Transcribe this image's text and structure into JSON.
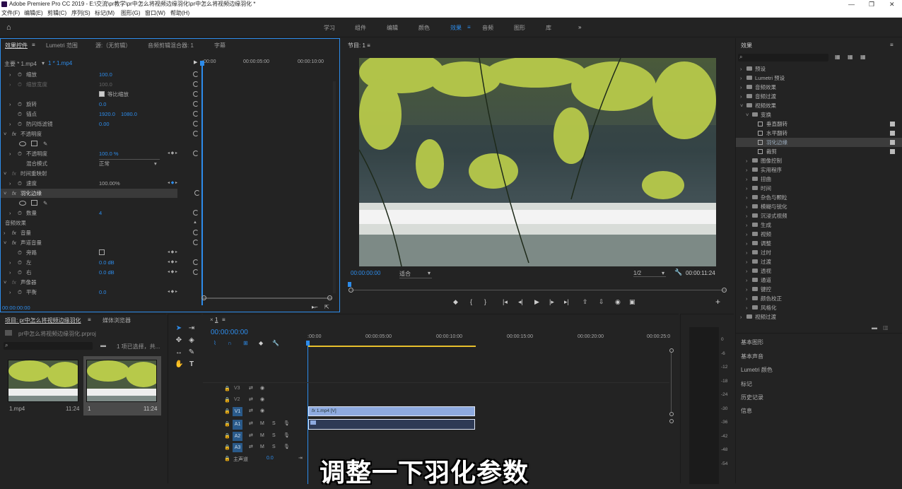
{
  "titlebar": {
    "title": "Adobe Premiere Pro CC 2019 - E:\\交流\\pr教学\\pr中怎么将视频边缘羽化\\pr中怎么将视频边缘羽化 *"
  },
  "menu": [
    "文件(F)",
    "编辑(E)",
    "剪辑(C)",
    "序列(S)",
    "标记(M)",
    "图形(G)",
    "窗口(W)",
    "帮助(H)"
  ],
  "workspace": {
    "tabs": [
      "学习",
      "组件",
      "编辑",
      "颜色",
      "效果",
      "音频",
      "图形",
      "库"
    ],
    "active": "效果",
    "more": "»"
  },
  "effect_controls": {
    "tabs": [
      "效果控件",
      "Lumetri 范围",
      "源:（无剪辑）",
      "音频剪辑混合器: 1",
      "字幕"
    ],
    "master": "主要 * 1.mp4",
    "clip": "1 * 1.mp4",
    "time_labels": [
      ":00:00",
      "00:00:05:00",
      "00:00:10:00"
    ],
    "rows": [
      {
        "name": "缩放",
        "value": "100.0"
      },
      {
        "name": "缩放宽度",
        "value": "100.0"
      },
      {
        "name": "等比缩放",
        "value": ""
      },
      {
        "name": "旋转",
        "value": "0.0"
      },
      {
        "name": "锚点",
        "value": "1920.0",
        "value2": "1080.0"
      },
      {
        "name": "防闪烁滤镜",
        "value": "0.00"
      },
      {
        "name": "不透明度",
        "value": ""
      },
      {
        "name": "不透明度",
        "value": "100.0 %"
      },
      {
        "name": "混合模式",
        "value": "正常"
      },
      {
        "name": "时间重映射",
        "value": ""
      },
      {
        "name": "速度",
        "value": "100.00%"
      },
      {
        "name": "羽化边缘",
        "value": ""
      },
      {
        "name": "数量",
        "value": "4"
      },
      {
        "name": "音频效果",
        "value": ""
      },
      {
        "name": "音量",
        "value": ""
      },
      {
        "name": "声道音量",
        "value": ""
      },
      {
        "name": "旁路",
        "value": ""
      },
      {
        "name": "左",
        "value": "0.0 dB"
      },
      {
        "name": "右",
        "value": "0.0 dB"
      },
      {
        "name": "声像器",
        "value": ""
      },
      {
        "name": "平衡",
        "value": "0.0"
      }
    ],
    "timecode": "00:00:00:00"
  },
  "program": {
    "tab": "节目: 1",
    "timecode": "00:00:00:00",
    "fit": "适合",
    "resolution": "1/2",
    "duration": "00:00:11:24"
  },
  "effects_panel": {
    "tab": "效果",
    "items": [
      {
        "label": "预设",
        "level": 0,
        "type": "folder"
      },
      {
        "label": "Lumetri 预设",
        "level": 0,
        "type": "folder"
      },
      {
        "label": "音频效果",
        "level": 0,
        "type": "folder"
      },
      {
        "label": "音频过渡",
        "level": 0,
        "type": "folder"
      },
      {
        "label": "视频效果",
        "level": 0,
        "type": "folder"
      },
      {
        "label": "变换",
        "level": 1,
        "type": "folder"
      },
      {
        "label": "垂直翻转",
        "level": 2,
        "type": "fx"
      },
      {
        "label": "水平翻转",
        "level": 2,
        "type": "fx"
      },
      {
        "label": "羽化边缘",
        "level": 2,
        "type": "fx",
        "selected": true
      },
      {
        "label": "裁剪",
        "level": 2,
        "type": "fx"
      },
      {
        "label": "图像控制",
        "level": 1,
        "type": "folder"
      },
      {
        "label": "实用程序",
        "level": 1,
        "type": "folder"
      },
      {
        "label": "扭曲",
        "level": 1,
        "type": "folder"
      },
      {
        "label": "时间",
        "level": 1,
        "type": "folder"
      },
      {
        "label": "杂色与颗粒",
        "level": 1,
        "type": "folder"
      },
      {
        "label": "模糊与锐化",
        "level": 1,
        "type": "folder"
      },
      {
        "label": "沉浸式视频",
        "level": 1,
        "type": "folder"
      },
      {
        "label": "生成",
        "level": 1,
        "type": "folder"
      },
      {
        "label": "视频",
        "level": 1,
        "type": "folder"
      },
      {
        "label": "调整",
        "level": 1,
        "type": "folder"
      },
      {
        "label": "过时",
        "level": 1,
        "type": "folder"
      },
      {
        "label": "过渡",
        "level": 1,
        "type": "folder"
      },
      {
        "label": "透视",
        "level": 1,
        "type": "folder"
      },
      {
        "label": "通道",
        "level": 1,
        "type": "folder"
      },
      {
        "label": "键控",
        "level": 1,
        "type": "folder"
      },
      {
        "label": "颜色校正",
        "level": 1,
        "type": "folder"
      },
      {
        "label": "风格化",
        "level": 1,
        "type": "folder"
      },
      {
        "label": "视频过渡",
        "level": 0,
        "type": "folder"
      }
    ],
    "sections": [
      "基本图形",
      "基本声音",
      "Lumetri 颜色",
      "标记",
      "历史记录",
      "信息"
    ]
  },
  "project": {
    "tabs": [
      "项目: pr中怎么将视频边缘羽化",
      "媒体浏览器"
    ],
    "file": "pr中怎么将视频边缘羽化.prproj",
    "selected": "1 项已选择，共...",
    "items": [
      {
        "name": "1.mp4",
        "duration": "11:24"
      },
      {
        "name": "1",
        "duration": "11:24"
      }
    ]
  },
  "timeline": {
    "tab": "1",
    "timecode": "00:00:00:00",
    "ruler": [
      ":00:00",
      "00:00:05:00",
      "00:00:10:00",
      "00:00:15:00",
      "00:00:20:00",
      "00:00:25:0"
    ],
    "tracks": [
      "V3",
      "V2",
      "V1",
      "A1",
      "A2",
      "A3"
    ],
    "master": "主声道",
    "master_val": "0.0",
    "clip_video": "1.mp4 [V]"
  },
  "meter_labels": [
    "0",
    "-6",
    "-12",
    "-18",
    "-24",
    "-30",
    "-36",
    "-42",
    "-48",
    "-54"
  ],
  "subtitle": "调整一下羽化参数"
}
